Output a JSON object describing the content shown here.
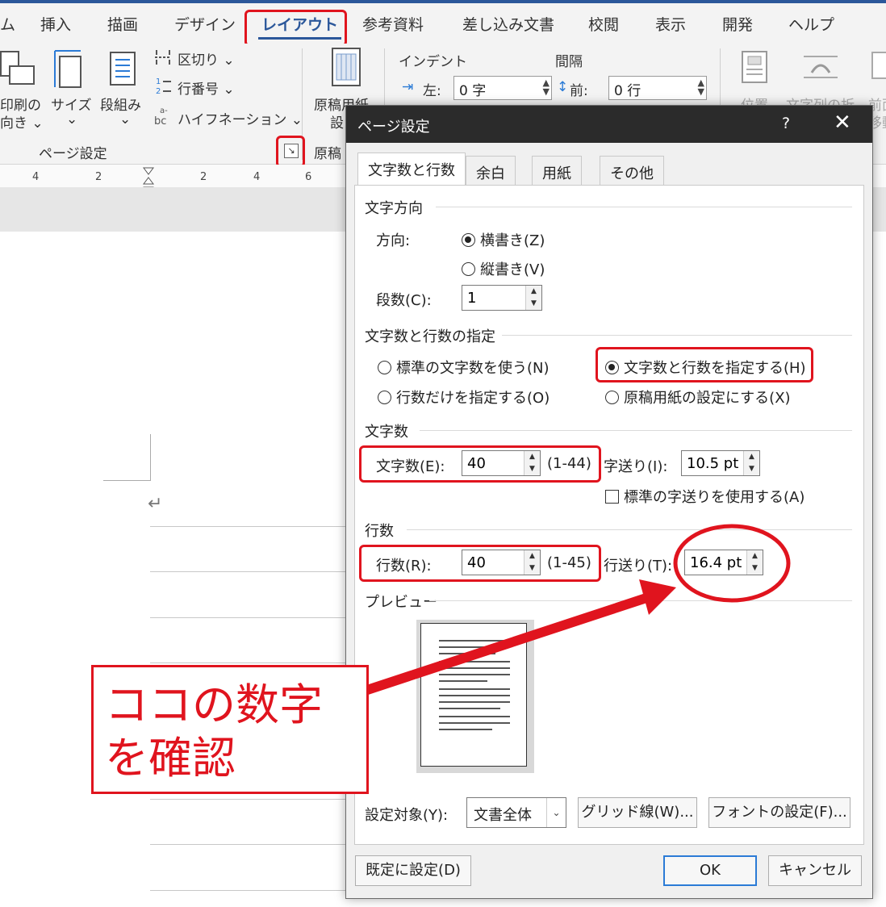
{
  "ribbon": {
    "tabs": [
      "ム",
      "挿入",
      "描画",
      "デザイン",
      "レイアウト",
      "参考資料",
      "差し込み文書",
      "校閲",
      "表示",
      "開発",
      "ヘルプ"
    ],
    "active_tab": "レイアウト",
    "print_direction_label": "印刷の",
    "print_direction_label2": "向き ⌄",
    "size_label": "サイズ",
    "size_dropdown": "⌄",
    "columns_label": "段組み",
    "columns_dropdown": "⌄",
    "breaks_label": "区切り ⌄",
    "line_numbers_label": "行番号 ⌄",
    "hyphenation_label": "ハイフネーション ⌄",
    "page_setup_group": "ページ設定",
    "genko_label": "原稿用紙",
    "genko_label2": "設",
    "genko_group": "原稿",
    "indent_label": "インデント",
    "spacing_label": "間隔",
    "indent_left_label": "左:",
    "indent_left_value": "0 字",
    "spacing_before_label": "前:",
    "spacing_before_value": "0 行",
    "position_label": "位置",
    "wrap_label": "文字列の折",
    "forward_label": "前面",
    "forward_label2": "移動"
  },
  "ruler": {
    "ticks": [
      "4",
      "2",
      "2",
      "4",
      "6"
    ]
  },
  "dialog": {
    "title": "ページ設定",
    "help": "?",
    "close": "✕",
    "tabs": [
      "文字数と行数",
      "余白",
      "用紙",
      "その他"
    ],
    "active_tab": "文字数と行数",
    "direction_section": "文字方向",
    "direction_label": "方向:",
    "horizontal_option": "横書き(Z)",
    "vertical_option": "縦書き(V)",
    "columns_label": "段数(C):",
    "columns_value": "1",
    "grid_section": "文字数と行数の指定",
    "opt_standard": "標準の文字数を使う(N)",
    "opt_chars_lines": "文字数と行数を指定する(H)",
    "opt_lines_only": "行数だけを指定する(O)",
    "opt_genko": "原稿用紙の設定にする(X)",
    "chars_section": "文字数",
    "chars_label": "文字数(E):",
    "chars_value": "40",
    "chars_range": "(1-44)",
    "char_pitch_label": "字送り(I):",
    "char_pitch_value": "10.5 pt",
    "standard_pitch_label": "標準の字送りを使用する(A)",
    "lines_section": "行数",
    "lines_label": "行数(R):",
    "lines_value": "40",
    "lines_range": "(1-45)",
    "line_pitch_label": "行送り(T):",
    "line_pitch_value": "16.4 pt",
    "preview_section": "プレビュー",
    "apply_label": "設定対象(Y):",
    "apply_value": "文書全体",
    "grid_button": "グリッド線(W)...",
    "font_button": "フォントの設定(F)...",
    "default_button": "既定に設定(D)",
    "ok_button": "OK",
    "cancel_button": "キャンセル"
  },
  "annotation": {
    "callout_text": "ココの数字を確認",
    "color": "#e0141e"
  },
  "colors": {
    "accent": "#2b579a",
    "titlebar": "#2b2b2b",
    "annotation": "#e0141e"
  }
}
